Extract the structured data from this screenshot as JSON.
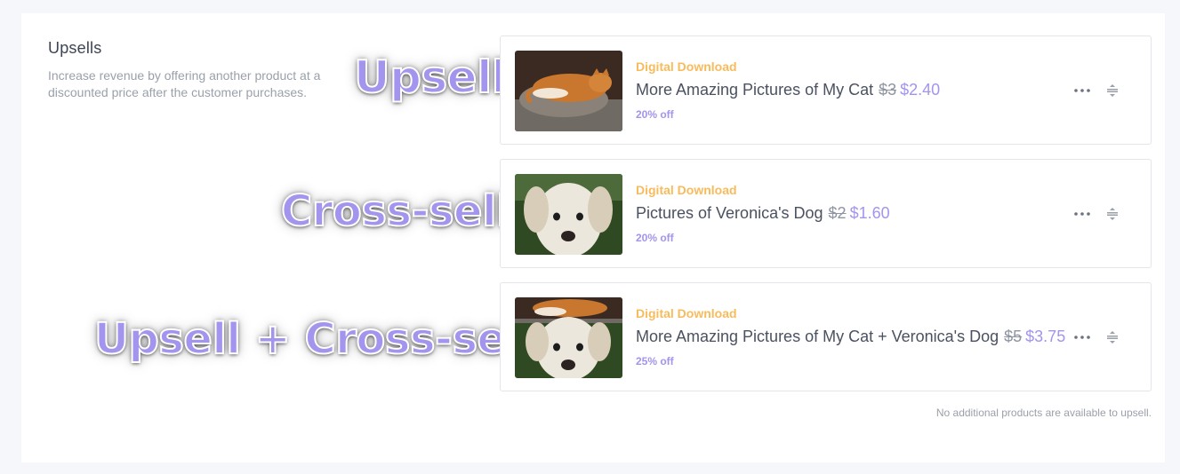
{
  "section": {
    "title": "Upsells",
    "description": "Increase revenue by offering another product at a discounted price after the customer purchases."
  },
  "overlay_labels": [
    "Upsell",
    "Cross-sell",
    "Upsell + Cross-sell"
  ],
  "items": [
    {
      "type": "Digital Download",
      "name": "More Amazing Pictures of My Cat",
      "old_price": "$3",
      "new_price": "$2.40",
      "discount": "20% off",
      "image": "cat-photo"
    },
    {
      "type": "Digital Download",
      "name": "Pictures of Veronica's Dog",
      "old_price": "$2",
      "new_price": "$1.60",
      "discount": "20% off",
      "image": "dog-photo"
    },
    {
      "type": "Digital Download",
      "name": "More Amazing Pictures of My Cat + Veronica's Dog",
      "old_price": "$5",
      "new_price": "$3.75",
      "discount": "25% off",
      "image": "cat-and-dog-photo"
    }
  ],
  "icons": {
    "menu": "more-horizontal-icon",
    "drag": "drag-handle-icon"
  },
  "colors": {
    "accent": "#a394ee",
    "type_label": "#f8bb5c"
  },
  "footer_note": "No additional products are available to upsell."
}
